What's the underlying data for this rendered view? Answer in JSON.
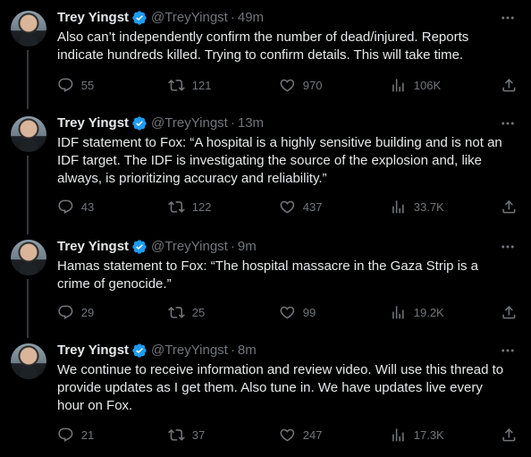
{
  "tweets": [
    {
      "name": "Trey Yingst",
      "handle": "@TreyYingst",
      "separator": "·",
      "time": "49m",
      "text": "Also can’t independently confirm the number of dead/injured. Reports indicate hundreds killed. Trying to confirm details. This will take time.",
      "replies": "55",
      "retweets": "121",
      "likes": "970",
      "views": "106K"
    },
    {
      "name": "Trey Yingst",
      "handle": "@TreyYingst",
      "separator": "·",
      "time": "13m",
      "text": "IDF statement to Fox: “A hospital is a highly sensitive building and is not an IDF target. The IDF is investigating the source of the explosion and, like always, is prioritizing accuracy and reliability.”",
      "replies": "43",
      "retweets": "122",
      "likes": "437",
      "views": "33.7K"
    },
    {
      "name": "Trey Yingst",
      "handle": "@TreyYingst",
      "separator": "·",
      "time": "9m",
      "text": "Hamas statement to Fox: “The hospital massacre in the Gaza Strip is a crime of genocide.”",
      "replies": "29",
      "retweets": "25",
      "likes": "99",
      "views": "19.2K"
    },
    {
      "name": "Trey Yingst",
      "handle": "@TreyYingst",
      "separator": "·",
      "time": "8m",
      "text": "We continue to receive information and review video. Will use this thread to provide updates as I get them. Also tune in. We have updates live every hour on Fox.",
      "replies": "21",
      "retweets": "37",
      "likes": "247",
      "views": "17.3K"
    }
  ],
  "colors": {
    "background": "#000000",
    "text": "#e7e9ea",
    "secondary": "#71767b",
    "verified": "#1d9bf0",
    "thread_line": "#333639"
  },
  "icons": [
    "verified-badge-icon",
    "more-icon",
    "reply-icon",
    "retweet-icon",
    "like-icon",
    "views-icon",
    "share-icon"
  ]
}
